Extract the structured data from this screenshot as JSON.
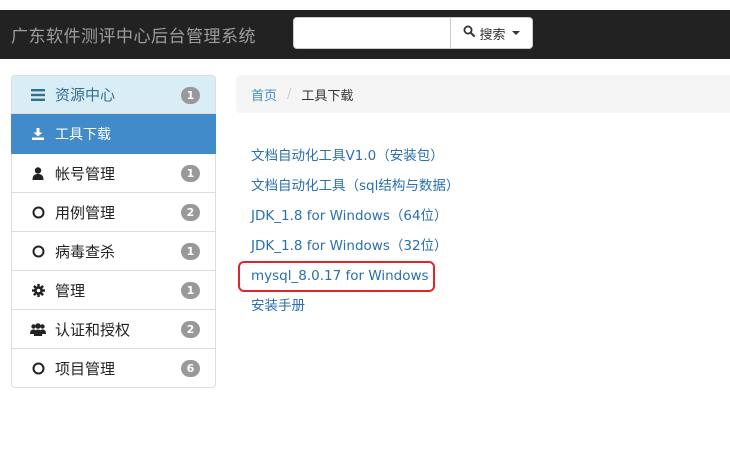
{
  "navbar": {
    "brand": "广东软件测评中心后台管理系统",
    "search": {
      "value": "",
      "placeholder": "",
      "button_label": "搜索"
    }
  },
  "sidebar": {
    "header": {
      "label": "资源中心",
      "badge": "1",
      "icon": "bars-icon"
    },
    "items": [
      {
        "label": "工具下载",
        "icon": "download-icon",
        "active": true
      },
      {
        "label": "帐号管理",
        "icon": "user-icon",
        "badge": "1"
      },
      {
        "label": "用例管理",
        "icon": "circle-icon",
        "badge": "2"
      },
      {
        "label": "病毒查杀",
        "icon": "circle-icon",
        "badge": "1"
      },
      {
        "label": "管理",
        "icon": "gear-icon",
        "badge": "1"
      },
      {
        "label": "认证和授权",
        "icon": "users-icon",
        "badge": "2"
      },
      {
        "label": "项目管理",
        "icon": "circle-icon",
        "badge": "6"
      }
    ]
  },
  "breadcrumb": {
    "home": "首页",
    "separator": "/",
    "current": "工具下载"
  },
  "downloads": [
    "文档自动化工具V1.0（安装包）",
    "文档自动化工具（sql结构与数据）",
    "JDK_1.8 for Windows（64位）",
    "JDK_1.8 for Windows（32位）",
    "mysql_8.0.17 for Windows",
    "安装手册"
  ],
  "colors": {
    "navbar_bg": "#222222",
    "link": "#2a6fb0",
    "active_item": "#428bca",
    "header_item": "#d9edf7",
    "highlight_border": "#e0262a"
  }
}
